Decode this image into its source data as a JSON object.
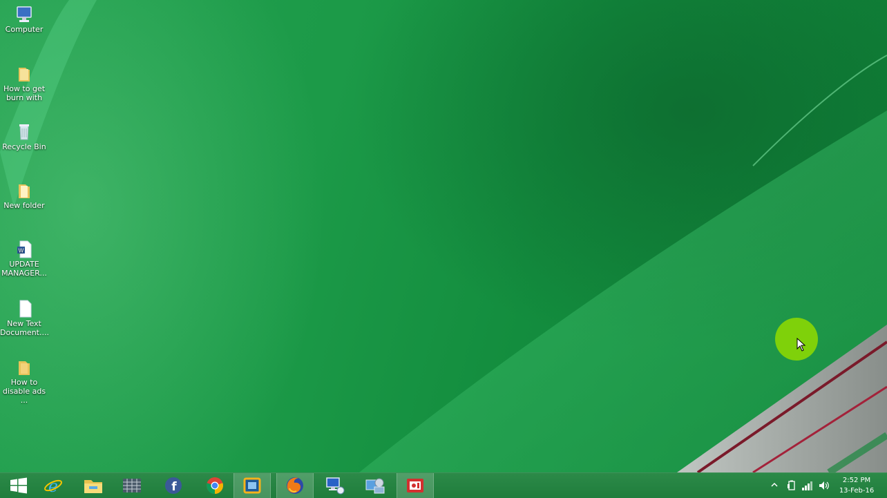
{
  "desktop": {
    "icons": [
      {
        "label": "Computer",
        "icon": "computer-icon"
      },
      {
        "label": "How to get burn with",
        "icon": "folder-icon"
      },
      {
        "label": "Recycle Bin",
        "icon": "recycle-bin-icon"
      },
      {
        "label": "New folder",
        "icon": "folder-icon"
      },
      {
        "label": "UPDATE MANAGER...",
        "icon": "word-document-icon"
      },
      {
        "label": "New Text Document....",
        "icon": "text-document-icon"
      },
      {
        "label": "How to disable ads ...",
        "icon": "folder-icon"
      }
    ]
  },
  "taskbar": {
    "items": [
      {
        "icon": "windows-start-icon"
      },
      {
        "icon": "internet-explorer-icon"
      },
      {
        "icon": "file-explorer-icon"
      },
      {
        "icon": "app-grid-icon"
      },
      {
        "icon": "facebook-icon"
      },
      {
        "icon": "chrome-icon"
      },
      {
        "icon": "virtualbox-icon",
        "active": true
      },
      {
        "icon": "firefox-icon",
        "active": true
      },
      {
        "icon": "network-computer-icon"
      },
      {
        "icon": "control-panel-icon"
      },
      {
        "icon": "screen-recorder-icon",
        "active": true
      }
    ],
    "tray": {
      "time": "2:52 PM",
      "date": "13-Feb-16"
    }
  },
  "colors": {
    "cursor_highlight": "#7fd10a",
    "taskbar": "#247f40"
  }
}
